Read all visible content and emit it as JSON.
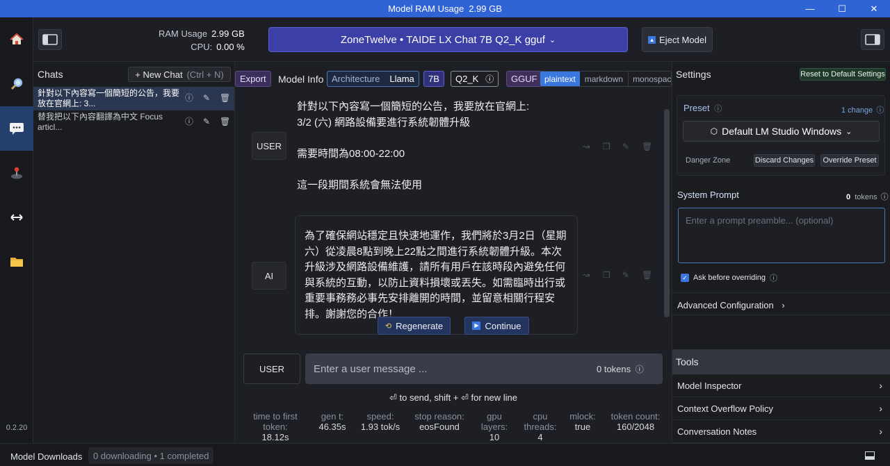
{
  "window": {
    "title": "Model RAM Usage",
    "ram_value": "2.99 GB"
  },
  "rail": {
    "version": "0.2.20"
  },
  "header": {
    "ram_label": "RAM Usage",
    "ram_value": "2.99 GB",
    "cpu_label": "CPU:",
    "cpu_value": "0.00 %",
    "model_name": "ZoneTwelve • TAIDE LX Chat 7B Q2_K gguf",
    "eject_label": "Eject Model"
  },
  "chats": {
    "title": "Chats",
    "new_chat_label": "+ New Chat",
    "new_chat_hint": "(Ctrl + N)",
    "items": [
      {
        "text": "針對以下內容寫一個簡短的公告，我要放在官網上: 3..."
      },
      {
        "text": "替我把以下內容翻譯為中文 Focus articl..."
      }
    ]
  },
  "infobar": {
    "export_label": "Export",
    "model_info_label": "Model Info",
    "architecture_label": "Architecture",
    "architecture_value": "Llama",
    "size_tag": "7B",
    "quant_tag": "Q2_K",
    "format_tag": "GGUF",
    "render_modes": [
      "plaintext",
      "markdown",
      "monospace"
    ]
  },
  "conversation": {
    "user_role": "USER",
    "user_message": "針對以下內容寫一個簡短的公告，我要放在官網上:\n3/2 (六) 網路設備要進行系統韌體升級\n\n需要時間為08:00-22:00\n\n這一段期間系統會無法使用",
    "ai_role": "AI",
    "ai_message": "為了確保網站穩定且快速地運作，我們將於3月2日（星期六）從凌晨8點到晚上22點之間進行系統韌體升級。本次升級涉及網路設備維護，請所有用戶在該時段內避免任何與系統的互動，以防止資料損壞或丟失。如需臨時出行或重要事務務必事先安排離開的時間，並留意相關行程安排。謝謝您的合作！",
    "regenerate_label": "Regenerate",
    "continue_label": "Continue"
  },
  "input": {
    "role_label": "USER",
    "placeholder": "Enter a user message ...",
    "token_count": "0 tokens",
    "send_hint": "⏎ to send, shift + ⏎ for new line"
  },
  "stats": [
    {
      "key": "time to first token:",
      "value": "18.12s"
    },
    {
      "key": "gen t:",
      "value": "46.35s"
    },
    {
      "key": "speed:",
      "value": "1.93 tok/s"
    },
    {
      "key": "stop reason:",
      "value": "eosFound"
    },
    {
      "key": "gpu layers:",
      "value": "10"
    },
    {
      "key": "cpu threads:",
      "value": "4"
    },
    {
      "key": "mlock:",
      "value": "true"
    },
    {
      "key": "token count:",
      "value": "160/2048"
    }
  ],
  "settings": {
    "title": "Settings",
    "reset_label": "Reset to Default Settings",
    "preset_label": "Preset",
    "preset_changes": "1 change",
    "preset_value": "Default LM Studio Windows",
    "danger_zone_label": "Danger Zone",
    "discard_label": "Discard Changes",
    "override_label": "Override Preset",
    "system_prompt_label": "System Prompt",
    "system_prompt_tokens": "0",
    "system_prompt_tokens_unit": "tokens",
    "system_prompt_placeholder": "Enter a prompt preamble... (optional)",
    "ask_before_overriding_label": "Ask before overriding",
    "advanced_label": "Advanced Configuration",
    "tools_title": "Tools",
    "tools": [
      "Model Inspector",
      "Context Overflow Policy",
      "Conversation Notes"
    ]
  },
  "footer": {
    "downloads_label": "Model Downloads",
    "downloads_status": "0 downloading • 1 completed"
  },
  "colors": {
    "titlebar": "#2f63d6",
    "model_select": "#3b3fa6",
    "accent_blue": "#3a78e0",
    "reset_green": "#1f3a2a"
  }
}
